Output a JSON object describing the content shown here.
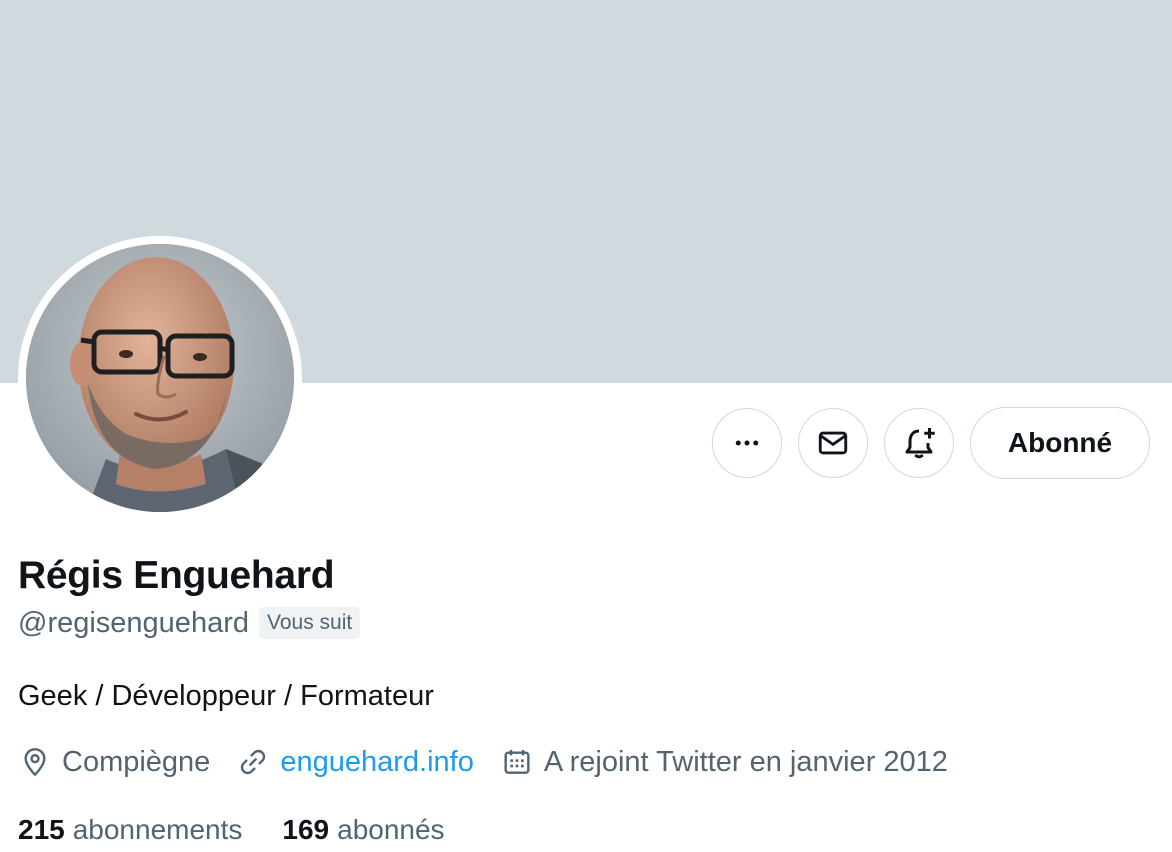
{
  "profile": {
    "name": "Régis Enguehard",
    "handle": "@regisenguehard",
    "follows_you": "Vous suit",
    "bio": "Geek / Développeur / Formateur",
    "location": "Compiègne",
    "website": "enguehard.info",
    "joined": "A rejoint Twitter en janvier 2012"
  },
  "actions": {
    "more_icon": "more-horizontal-icon",
    "message_icon": "envelope-icon",
    "notify_icon": "bell-plus-icon",
    "follow_label": "Abonné"
  },
  "stats": {
    "following_count": "215",
    "following_label": "abonnements",
    "followers_count": "169",
    "followers_label": "abonnés"
  },
  "colors": {
    "banner": "#cfd9de",
    "link": "#1d9bf0",
    "secondary_text": "#536471",
    "primary_text": "#0f1419"
  }
}
